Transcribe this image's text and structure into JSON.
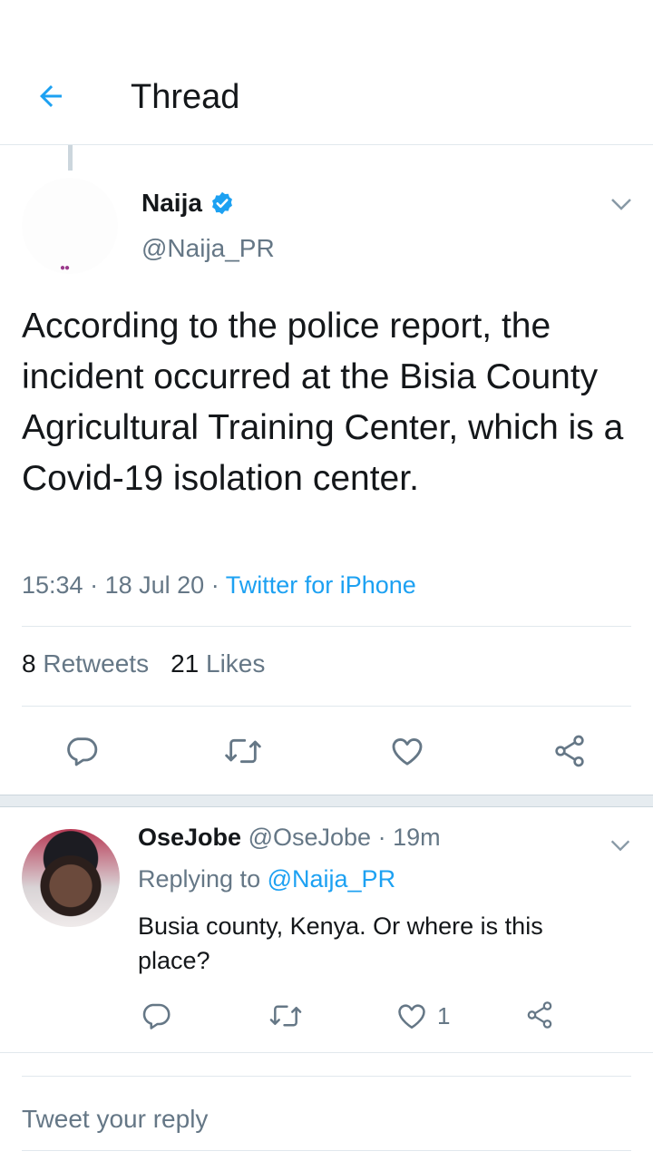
{
  "header": {
    "title": "Thread"
  },
  "tweet": {
    "author_name": "Naija",
    "author_handle": "@Naija_PR",
    "text": "According to the police report, the incident occurred at the Bisia County Agricultural Training Center, which is a Covid-19 isolation center.",
    "time": "15:34",
    "date": "18 Jul 20",
    "source": "Twitter for iPhone",
    "retweets_count": "8",
    "retweets_label": "Retweets",
    "likes_count": "21",
    "likes_label": "Likes"
  },
  "reply": {
    "author_name": "OseJobe",
    "author_handle": "@OseJobe",
    "age": "19m",
    "replying_prefix": "Replying to",
    "replying_to": "@Naija_PR",
    "text": "Busia county, Kenya. Or where is this place?",
    "likes_count": "1"
  },
  "composer": {
    "placeholder": "Tweet your reply"
  },
  "colors": {
    "accent": "#1da1f2",
    "secondary_text": "#657786",
    "divider": "#e1e8ed"
  },
  "icons": [
    "back-arrow-icon",
    "verified-badge-icon",
    "chevron-down-icon",
    "reply-icon",
    "retweet-icon",
    "heart-icon",
    "share-icon"
  ]
}
